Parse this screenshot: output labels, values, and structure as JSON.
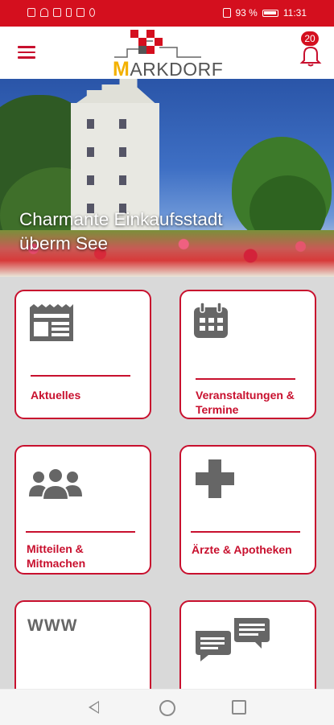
{
  "status_bar": {
    "battery": "93 %",
    "time": "11:31"
  },
  "app_bar": {
    "logo_text": "MARKDORF",
    "logo_initial": "M",
    "logo_rest": "ARKDORF",
    "notifications_count": "20",
    "menu_icon": "hamburger-menu-icon",
    "bell_icon": "bell-icon"
  },
  "hero": {
    "caption_line1": "Charmante Einkaufsstadt",
    "caption_line2": "überm See"
  },
  "tiles": [
    {
      "label": "Aktuelles",
      "icon": "newspaper-icon"
    },
    {
      "label": "Veranstaltungen & Termine",
      "icon": "calendar-icon"
    },
    {
      "label": "Mitteilen & Mitmachen",
      "icon": "people-group-icon"
    },
    {
      "label": "Ärzte & Apotheken",
      "icon": "medical-cross-icon"
    },
    {
      "label": "",
      "icon": "www-icon",
      "icon_text": "WWW"
    },
    {
      "label": "",
      "icon": "chat-bubbles-icon"
    }
  ],
  "colors": {
    "brand_red": "#c8102e",
    "status_red": "#d40f1e",
    "logo_yellow": "#f3b100",
    "icon_grey": "#666666"
  },
  "nav": {
    "back_icon": "back-triangle-icon",
    "home_icon": "home-circle-icon",
    "recents_icon": "recents-square-icon"
  }
}
